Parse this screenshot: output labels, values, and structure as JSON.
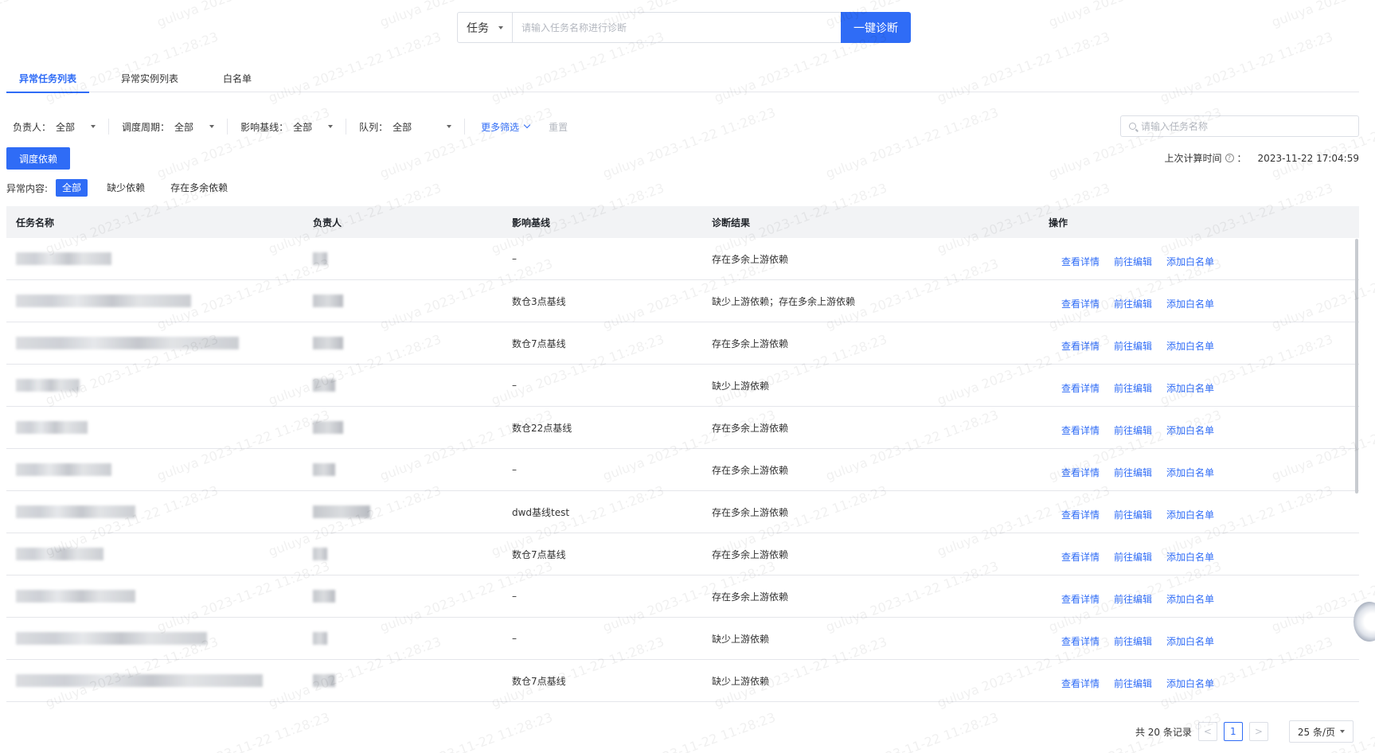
{
  "search": {
    "type_label": "任务",
    "placeholder": "请输入任务名称进行诊断",
    "button_label": "一键诊断"
  },
  "tabs": [
    {
      "label": "异常任务列表",
      "active": true
    },
    {
      "label": "异常实例列表",
      "active": false
    },
    {
      "label": "白名单",
      "active": false
    }
  ],
  "filters": {
    "owner": {
      "label": "负责人：",
      "value": "全部"
    },
    "cycle": {
      "label": "调度周期：",
      "value": "全部"
    },
    "baseline": {
      "label": "影响基线：",
      "value": "全部"
    },
    "queue": {
      "label": "队列：",
      "value": "全部"
    },
    "more_label": "更多筛选",
    "reset_label": "重置",
    "name_search_placeholder": "请输入任务名称"
  },
  "dependency_button": "调度依赖",
  "last_calc": {
    "label": "上次计算时间",
    "colon": "：",
    "time": "2023-11-22 17:04:59"
  },
  "abnormal": {
    "label": "异常内容:",
    "chips": [
      {
        "label": "全部",
        "active": true
      },
      {
        "label": "缺少依赖",
        "active": false
      },
      {
        "label": "存在多余依赖",
        "active": false
      }
    ]
  },
  "table": {
    "columns": [
      "任务名称",
      "负责人",
      "影响基线",
      "诊断结果",
      "操作"
    ],
    "actions": [
      "查看详情",
      "前往编辑",
      "添加白名单"
    ],
    "rows": [
      {
        "baseline": "–",
        "result": "存在多余上游依赖"
      },
      {
        "baseline": "数仓3点基线",
        "result": "缺少上游依赖；存在多余上游依赖"
      },
      {
        "baseline": "数仓7点基线",
        "result": "存在多余上游依赖"
      },
      {
        "baseline": "–",
        "result": "缺少上游依赖"
      },
      {
        "baseline": "数仓22点基线",
        "result": "存在多余上游依赖"
      },
      {
        "baseline": "–",
        "result": "存在多余上游依赖"
      },
      {
        "baseline": "dwd基线test",
        "result": "存在多余上游依赖"
      },
      {
        "baseline": "数仓7点基线",
        "result": "存在多余上游依赖"
      },
      {
        "baseline": "–",
        "result": "存在多余上游依赖"
      },
      {
        "baseline": "–",
        "result": "缺少上游依赖"
      },
      {
        "baseline": "数仓7点基线",
        "result": "缺少上游依赖"
      }
    ]
  },
  "pagination": {
    "total_label": "共 20 条记录",
    "prev": "<",
    "current": "1",
    "next": ">",
    "page_size": "25 条/页"
  },
  "watermark_text": "guluya 2023-11-22 11:28:23",
  "colors": {
    "primary": "#2f6cf6"
  }
}
